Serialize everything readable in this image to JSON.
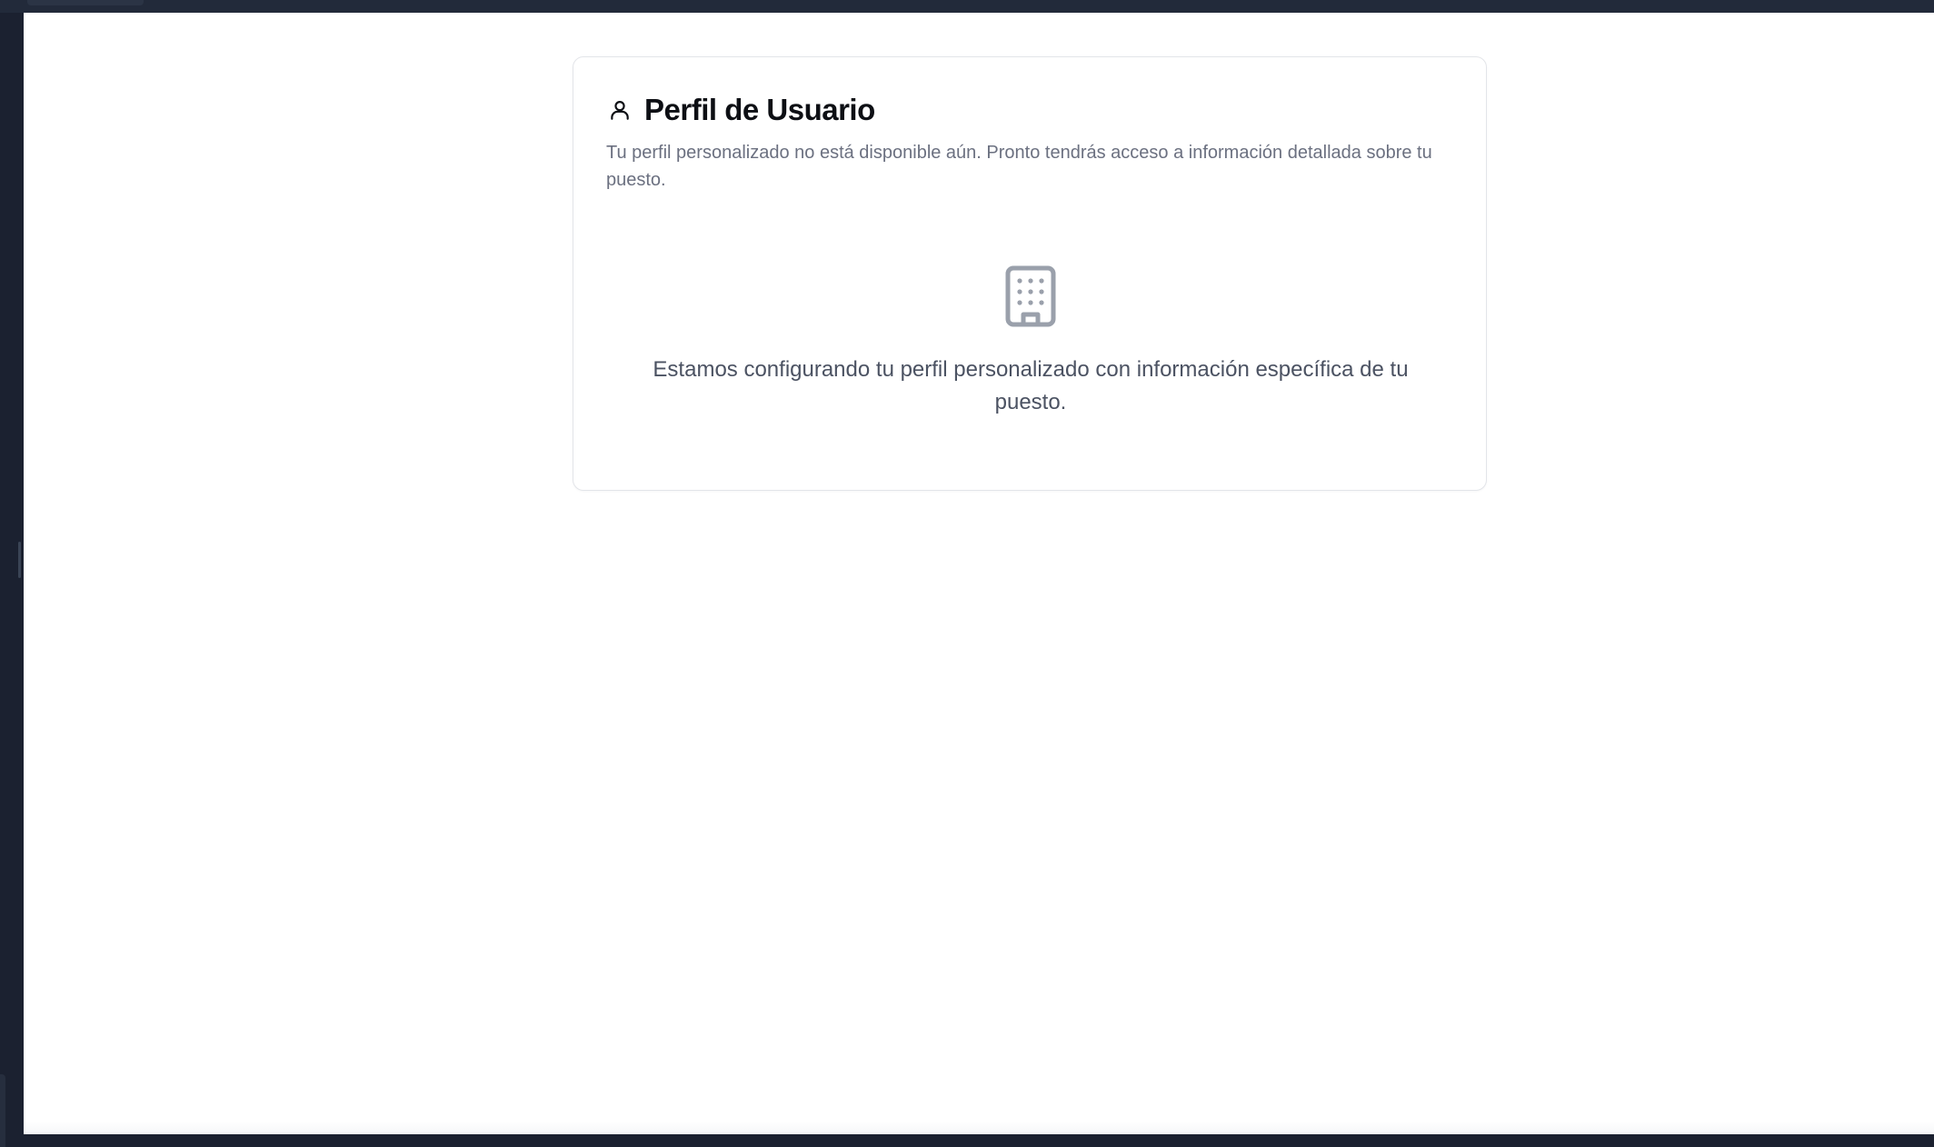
{
  "card": {
    "title": "Perfil de Usuario",
    "description": "Tu perfil personalizado no está disponible aún. Pronto tendrás acceso a información detallada sobre tu puesto.",
    "title_icon": "user-icon",
    "empty_state": {
      "icon": "building-icon",
      "message": "Estamos configurando tu perfil personalizado con información específica de tu puesto."
    }
  },
  "colors": {
    "title": "#0d0f14",
    "description": "#6b7080",
    "message": "#4b5262",
    "icon_muted": "#9aa0ab",
    "card_border": "#e3e5e9",
    "app_chrome": "#1b2130"
  }
}
